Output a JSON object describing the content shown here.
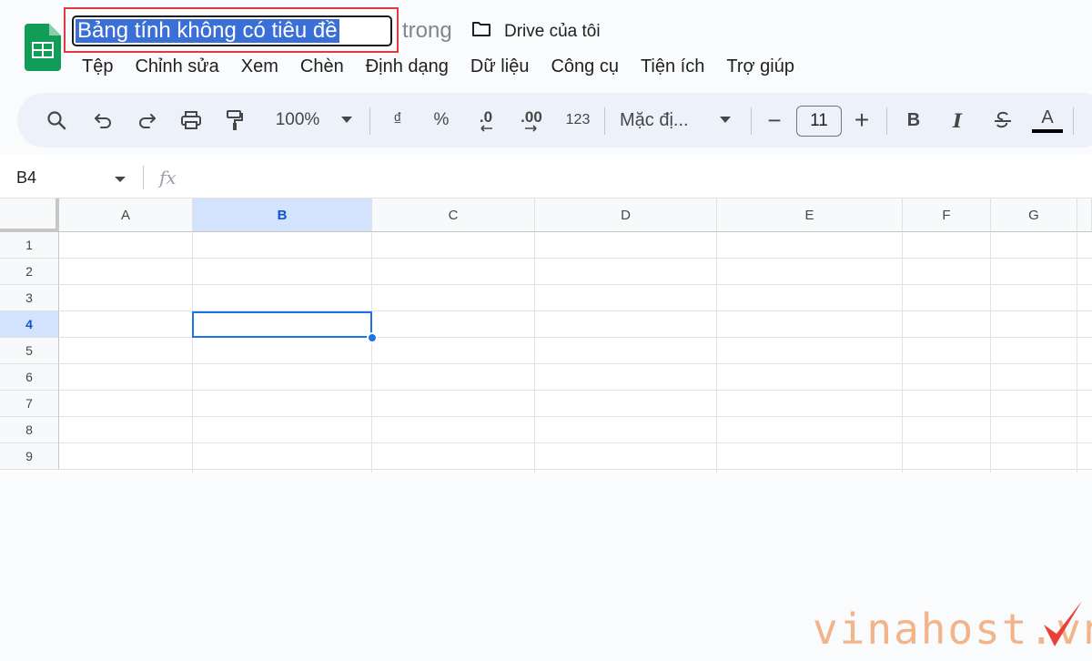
{
  "document": {
    "title": "Bảng tính không có tiêu đề",
    "location_prefix": "trong",
    "location": "Drive của tôi"
  },
  "menu": [
    "Tệp",
    "Chỉnh sửa",
    "Xem",
    "Chèn",
    "Định dạng",
    "Dữ liệu",
    "Công cụ",
    "Tiện ích",
    "Trợ giúp"
  ],
  "toolbar": {
    "zoom": "100%",
    "currency": "₫",
    "percent": "%",
    "decrease_decimal": ".0",
    "increase_decimal": ".00",
    "number_format": "123",
    "font": "Mặc đị...",
    "font_size": "11",
    "minus": "−",
    "plus": "+",
    "bold": "B",
    "italic": "I",
    "text_color": "A"
  },
  "formula_bar": {
    "cell_ref": "B4",
    "fx": "fx"
  },
  "grid": {
    "columns": [
      "A",
      "B",
      "C",
      "D",
      "E",
      "F",
      "G"
    ],
    "rows": [
      "1",
      "2",
      "3",
      "4",
      "5",
      "6",
      "7",
      "8",
      "9"
    ],
    "selected_column": "B",
    "selected_row": "4"
  },
  "watermark": {
    "text": "vinahost.vn"
  },
  "colors": {
    "accent": "#1a73e8",
    "selection_header": "#d3e3fd",
    "title_highlight": "#3a6fd8",
    "annotation_box": "#e0393e",
    "sheets_green": "#0f9d58"
  }
}
